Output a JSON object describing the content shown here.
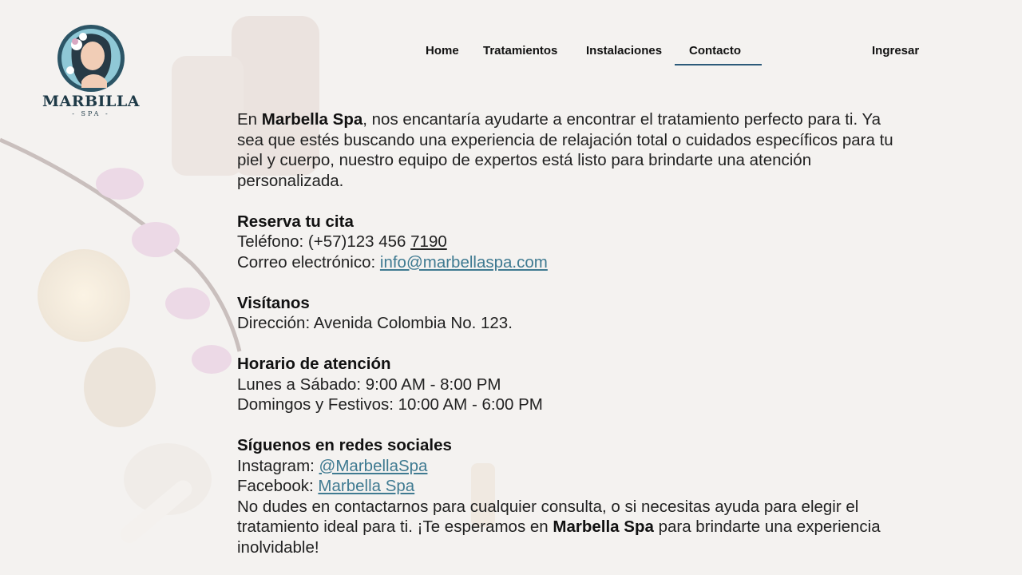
{
  "brand": {
    "name": "MARBILLA",
    "sub": "- SPA -"
  },
  "nav": {
    "home": "Home",
    "tratamientos": "Tratamientos",
    "instalaciones": "Instalaciones",
    "contacto": "Contacto",
    "ingresar": "Ingresar"
  },
  "intro": {
    "pre": "En ",
    "brand": "Marbella Spa",
    "post": ", nos encantaría ayudarte a encontrar el tratamiento perfecto para ti. Ya sea que estés buscando una experiencia de relajación total o cuidados específicos para tu piel y cuerpo, nuestro equipo de expertos está listo para brindarte una atención personalizada."
  },
  "reserva": {
    "title": "Reserva tu cita",
    "phone_label": "Teléfono: ",
    "phone_main": "(+57)123 456 ",
    "phone_tail": "7190",
    "email_label": "Correo electrónico: ",
    "email": "info@marbellaspa.com"
  },
  "visita": {
    "title": "Visítanos",
    "address": "Dirección: Avenida Colombia No. 123."
  },
  "horario": {
    "title": "Horario de atención",
    "weekdays": "Lunes a Sábado: 9:00 AM - 8:00 PM",
    "sundays": "Domingos y Festivos: 10:00 AM - 6:00 PM"
  },
  "redes": {
    "title": "Síguenos en redes sociales",
    "instagram_label": "Instagram: ",
    "instagram": "@MarbellaSpa",
    "facebook_label": "Facebook: ",
    "facebook": "Marbella Spa"
  },
  "closing": {
    "pre": "No dudes en contactarnos para cualquier consulta, o si necesitas ayuda para elegir el tratamiento ideal para ti. ¡Te esperamos en ",
    "brand": "Marbella Spa",
    "post": " para brindarte una experiencia inolvidable!"
  }
}
